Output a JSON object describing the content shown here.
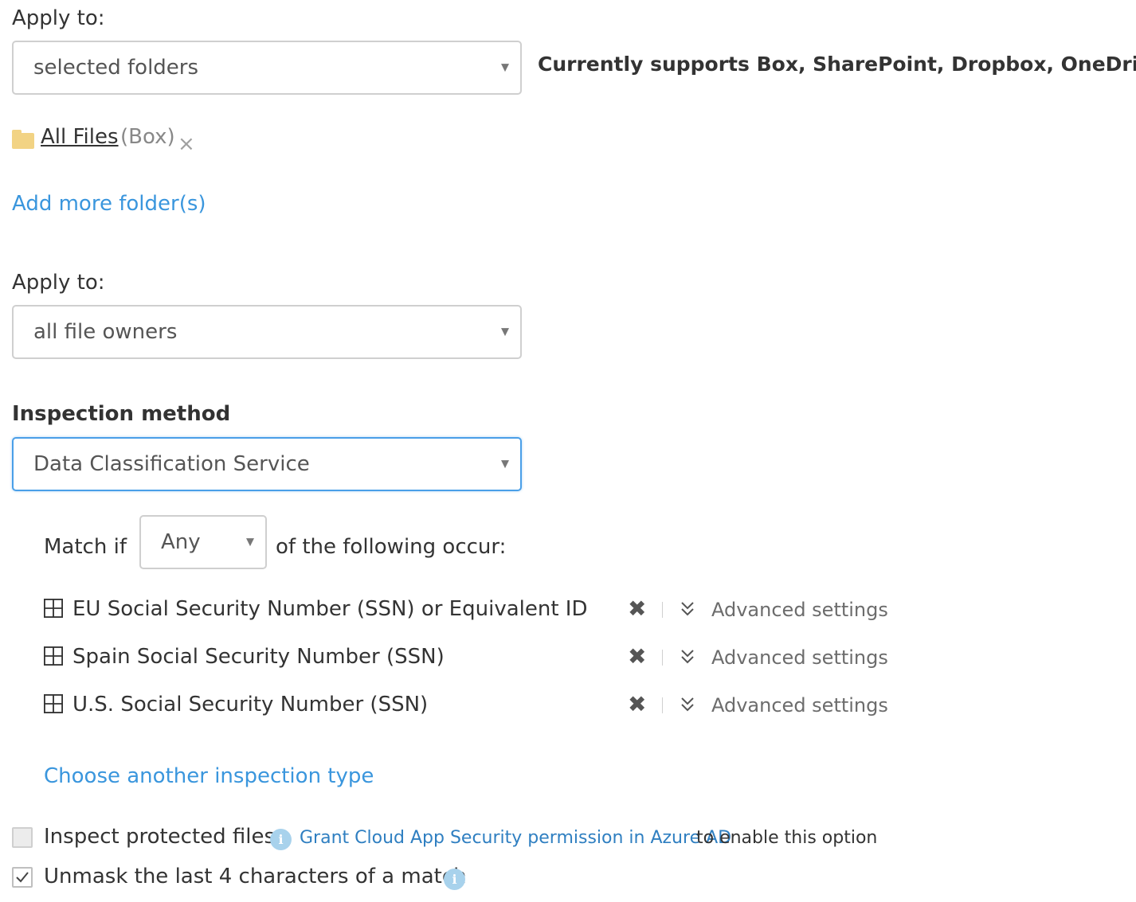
{
  "scope_section": {
    "apply_to_label": "Apply to:",
    "apply_to_value": "selected folders",
    "support_note": "Currently supports Box, SharePoint, Dropbox, OneDrive.",
    "selected_folders": [
      {
        "name": "All Files",
        "source": "(Box)",
        "remove_glyph": "×"
      }
    ],
    "add_folders_link": "Add more folder(s)"
  },
  "owners_section": {
    "apply_to_label": "Apply to:",
    "apply_to_value": "all file owners"
  },
  "inspection": {
    "label": "Inspection method",
    "method_value": "Data Classification Service",
    "match_prefix": "Match if",
    "match_value": "Any",
    "match_suffix": "of the following occur:",
    "rules": [
      {
        "label": "EU Social Security Number (SSN) or Equivalent ID",
        "advanced_label": "Advanced settings"
      },
      {
        "label": "Spain Social Security Number (SSN)",
        "advanced_label": "Advanced settings"
      },
      {
        "label": "U.S. Social Security Number (SSN)",
        "advanced_label": "Advanced settings"
      }
    ],
    "choose_another_link": "Choose another inspection type"
  },
  "options": {
    "inspect_protected": {
      "label": "Inspect protected files",
      "checked": false,
      "disabled": true,
      "info_link": "Grant Cloud App Security permission in Azure AD",
      "info_suffix": "to enable this option"
    },
    "unmask": {
      "label": "Unmask the last 4 characters of a match",
      "checked": true
    }
  },
  "icons": {
    "caret": "▼",
    "info": "i",
    "delete": "✖",
    "folder": "folder-icon",
    "grid": "grid-icon",
    "chevron": "double-chevron-down-icon"
  },
  "colors": {
    "link_blue": "#3a96dd",
    "focus_blue": "#4a9fe8",
    "folder_yellow": "#f2d384",
    "info_blue": "#a8d2ec"
  }
}
